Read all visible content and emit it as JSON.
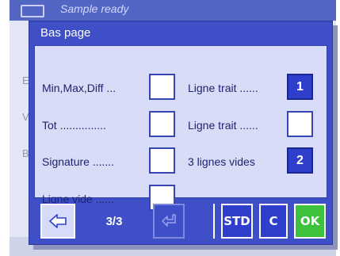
{
  "background": {
    "title": "Sample ready",
    "rows": [
      {
        "label": "En"
      },
      {
        "label": "Vo"
      },
      {
        "label": "Bo"
      }
    ]
  },
  "dialog": {
    "title": "Bas page",
    "options_left": [
      {
        "label": "Min,Max,Diff ...",
        "value": ""
      },
      {
        "label": "Tot ...............",
        "value": ""
      },
      {
        "label": "Signature .......",
        "value": ""
      },
      {
        "label": "Ligne vide ......",
        "value": ""
      }
    ],
    "options_right": [
      {
        "label": "Ligne trait ......",
        "value": "1"
      },
      {
        "label": "Ligne trait ......",
        "value": ""
      },
      {
        "label": "3 lignes vides",
        "value": "2"
      }
    ]
  },
  "footer": {
    "prev_icon": "arrow-left-icon",
    "page_indicator": "3/3",
    "next_icon": "arrow-turn-down-left-icon",
    "std_label": "STD",
    "c_label": "C",
    "ok_label": "OK"
  },
  "colors": {
    "dialog_bg": "#3f4fc8",
    "body_bg": "#d8dcf6",
    "selected_box": "#2f3fcc",
    "ok_green": "#3ec23e"
  }
}
